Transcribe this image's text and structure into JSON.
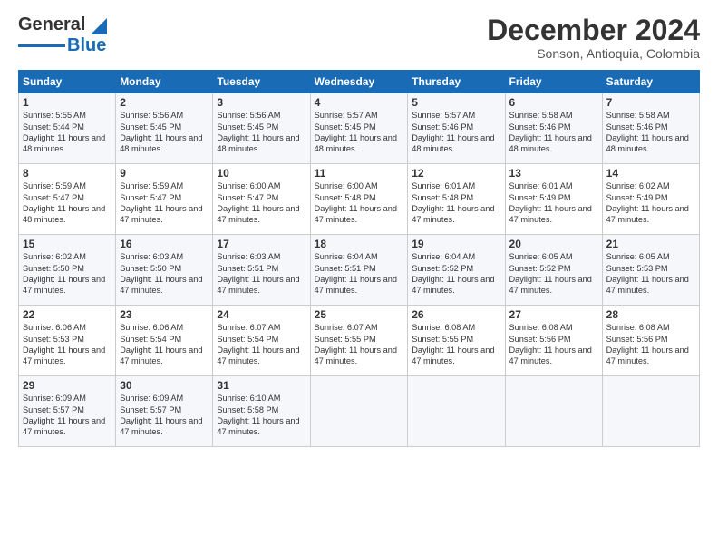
{
  "header": {
    "logo_line1": "General",
    "logo_line2": "Blue",
    "title": "December 2024",
    "subtitle": "Sonson, Antioquia, Colombia"
  },
  "days_of_week": [
    "Sunday",
    "Monday",
    "Tuesday",
    "Wednesday",
    "Thursday",
    "Friday",
    "Saturday"
  ],
  "weeks": [
    [
      {
        "day": "1",
        "sunrise": "5:55 AM",
        "sunset": "5:44 PM",
        "daylight": "11 hours and 48 minutes."
      },
      {
        "day": "2",
        "sunrise": "5:56 AM",
        "sunset": "5:45 PM",
        "daylight": "11 hours and 48 minutes."
      },
      {
        "day": "3",
        "sunrise": "5:56 AM",
        "sunset": "5:45 PM",
        "daylight": "11 hours and 48 minutes."
      },
      {
        "day": "4",
        "sunrise": "5:57 AM",
        "sunset": "5:45 PM",
        "daylight": "11 hours and 48 minutes."
      },
      {
        "day": "5",
        "sunrise": "5:57 AM",
        "sunset": "5:46 PM",
        "daylight": "11 hours and 48 minutes."
      },
      {
        "day": "6",
        "sunrise": "5:58 AM",
        "sunset": "5:46 PM",
        "daylight": "11 hours and 48 minutes."
      },
      {
        "day": "7",
        "sunrise": "5:58 AM",
        "sunset": "5:46 PM",
        "daylight": "11 hours and 48 minutes."
      }
    ],
    [
      {
        "day": "8",
        "sunrise": "5:59 AM",
        "sunset": "5:47 PM",
        "daylight": "11 hours and 48 minutes."
      },
      {
        "day": "9",
        "sunrise": "5:59 AM",
        "sunset": "5:47 PM",
        "daylight": "11 hours and 47 minutes."
      },
      {
        "day": "10",
        "sunrise": "6:00 AM",
        "sunset": "5:47 PM",
        "daylight": "11 hours and 47 minutes."
      },
      {
        "day": "11",
        "sunrise": "6:00 AM",
        "sunset": "5:48 PM",
        "daylight": "11 hours and 47 minutes."
      },
      {
        "day": "12",
        "sunrise": "6:01 AM",
        "sunset": "5:48 PM",
        "daylight": "11 hours and 47 minutes."
      },
      {
        "day": "13",
        "sunrise": "6:01 AM",
        "sunset": "5:49 PM",
        "daylight": "11 hours and 47 minutes."
      },
      {
        "day": "14",
        "sunrise": "6:02 AM",
        "sunset": "5:49 PM",
        "daylight": "11 hours and 47 minutes."
      }
    ],
    [
      {
        "day": "15",
        "sunrise": "6:02 AM",
        "sunset": "5:50 PM",
        "daylight": "11 hours and 47 minutes."
      },
      {
        "day": "16",
        "sunrise": "6:03 AM",
        "sunset": "5:50 PM",
        "daylight": "11 hours and 47 minutes."
      },
      {
        "day": "17",
        "sunrise": "6:03 AM",
        "sunset": "5:51 PM",
        "daylight": "11 hours and 47 minutes."
      },
      {
        "day": "18",
        "sunrise": "6:04 AM",
        "sunset": "5:51 PM",
        "daylight": "11 hours and 47 minutes."
      },
      {
        "day": "19",
        "sunrise": "6:04 AM",
        "sunset": "5:52 PM",
        "daylight": "11 hours and 47 minutes."
      },
      {
        "day": "20",
        "sunrise": "6:05 AM",
        "sunset": "5:52 PM",
        "daylight": "11 hours and 47 minutes."
      },
      {
        "day": "21",
        "sunrise": "6:05 AM",
        "sunset": "5:53 PM",
        "daylight": "11 hours and 47 minutes."
      }
    ],
    [
      {
        "day": "22",
        "sunrise": "6:06 AM",
        "sunset": "5:53 PM",
        "daylight": "11 hours and 47 minutes."
      },
      {
        "day": "23",
        "sunrise": "6:06 AM",
        "sunset": "5:54 PM",
        "daylight": "11 hours and 47 minutes."
      },
      {
        "day": "24",
        "sunrise": "6:07 AM",
        "sunset": "5:54 PM",
        "daylight": "11 hours and 47 minutes."
      },
      {
        "day": "25",
        "sunrise": "6:07 AM",
        "sunset": "5:55 PM",
        "daylight": "11 hours and 47 minutes."
      },
      {
        "day": "26",
        "sunrise": "6:08 AM",
        "sunset": "5:55 PM",
        "daylight": "11 hours and 47 minutes."
      },
      {
        "day": "27",
        "sunrise": "6:08 AM",
        "sunset": "5:56 PM",
        "daylight": "11 hours and 47 minutes."
      },
      {
        "day": "28",
        "sunrise": "6:08 AM",
        "sunset": "5:56 PM",
        "daylight": "11 hours and 47 minutes."
      }
    ],
    [
      {
        "day": "29",
        "sunrise": "6:09 AM",
        "sunset": "5:57 PM",
        "daylight": "11 hours and 47 minutes."
      },
      {
        "day": "30",
        "sunrise": "6:09 AM",
        "sunset": "5:57 PM",
        "daylight": "11 hours and 47 minutes."
      },
      {
        "day": "31",
        "sunrise": "6:10 AM",
        "sunset": "5:58 PM",
        "daylight": "11 hours and 47 minutes."
      },
      null,
      null,
      null,
      null
    ]
  ]
}
